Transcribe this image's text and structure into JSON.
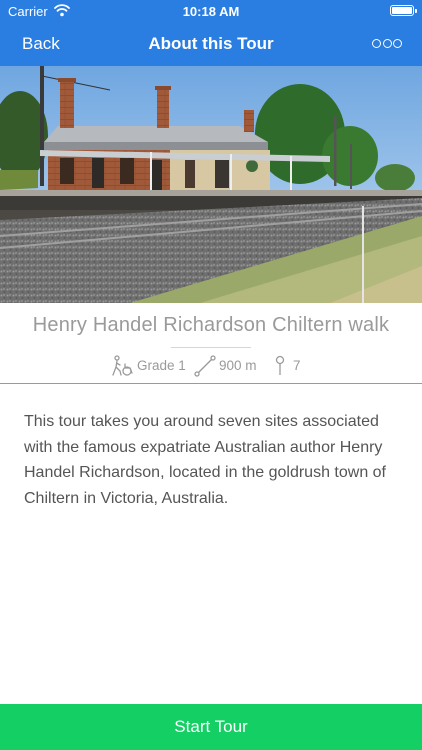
{
  "status_bar": {
    "carrier": "Carrier",
    "time": "10:18 AM"
  },
  "nav": {
    "back_label": "Back",
    "title": "About this Tour",
    "more_icon": "more-horizontal-icon"
  },
  "colors": {
    "nav_background": "#2a7de1",
    "start_button": "#13cf64",
    "muted_text": "#9a9a9a",
    "body_text": "#555555"
  },
  "tour": {
    "title": "Henry Handel Richardson Chiltern walk",
    "grade": "Grade 1",
    "distance": "900 m",
    "stops": "7",
    "description": "This tour takes you around seven sites associated with the famous expatriate Australian author Henry Handel Richardson, located in the goldrush town of Chiltern in Victoria, Australia."
  },
  "footer": {
    "start_label": "Start Tour"
  }
}
